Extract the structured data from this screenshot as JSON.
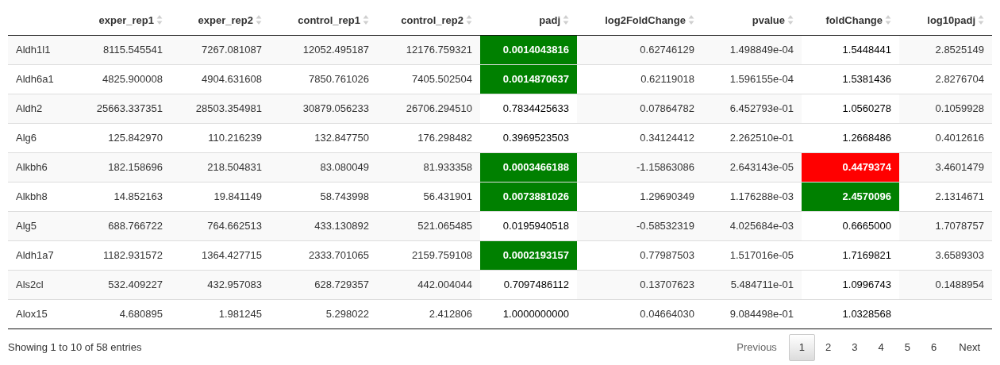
{
  "table": {
    "columns": [
      {
        "label": "exper_rep1",
        "kind": "plain"
      },
      {
        "label": "exper_rep2",
        "kind": "plain"
      },
      {
        "label": "control_rep1",
        "kind": "plain"
      },
      {
        "label": "control_rep2",
        "kind": "plain"
      },
      {
        "label": "padj",
        "kind": "flagged"
      },
      {
        "label": "log2FoldChange",
        "kind": "plain"
      },
      {
        "label": "pvalue",
        "kind": "plain"
      },
      {
        "label": "foldChange",
        "kind": "flagged"
      },
      {
        "label": "log10padj",
        "kind": "plain"
      }
    ],
    "rows": [
      {
        "gene": "Aldh1l1",
        "cells": [
          "8115.545541",
          "7267.081087",
          "12052.495187",
          "12176.759321",
          {
            "text": "0.0014043816",
            "color": "#008000"
          },
          "0.62746129",
          "1.498849e-04",
          "1.5448441",
          "2.8525149"
        ]
      },
      {
        "gene": "Aldh6a1",
        "cells": [
          "4825.900008",
          "4904.631608",
          "7850.761026",
          "7405.502504",
          {
            "text": "0.0014870637",
            "color": "#008000"
          },
          "0.62119018",
          "1.596155e-04",
          "1.5381436",
          "2.8276704"
        ]
      },
      {
        "gene": "Aldh2",
        "cells": [
          "25663.337351",
          "28503.354981",
          "30879.056233",
          "26706.294510",
          "0.7834425633",
          "0.07864782",
          "6.452793e-01",
          "1.0560278",
          "0.1059928"
        ]
      },
      {
        "gene": "Alg6",
        "cells": [
          "125.842970",
          "110.216239",
          "132.847750",
          "176.298482",
          "0.3969523503",
          "0.34124412",
          "2.262510e-01",
          "1.2668486",
          "0.4012616"
        ]
      },
      {
        "gene": "Alkbh6",
        "cells": [
          "182.158696",
          "218.504831",
          "83.080049",
          "81.933358",
          {
            "text": "0.0003466188",
            "color": "#008000"
          },
          "-1.15863086",
          "2.643143e-05",
          {
            "text": "0.4479374",
            "color": "#ff0000"
          },
          "3.4601479"
        ]
      },
      {
        "gene": "Alkbh8",
        "cells": [
          "14.852163",
          "19.841149",
          "58.743998",
          "56.431901",
          {
            "text": "0.0073881026",
            "color": "#008000"
          },
          "1.29690349",
          "1.176288e-03",
          {
            "text": "2.4570096",
            "color": "#008000"
          },
          "2.1314671"
        ]
      },
      {
        "gene": "Alg5",
        "cells": [
          "688.766722",
          "764.662513",
          "433.130892",
          "521.065485",
          "0.0195940518",
          "-0.58532319",
          "4.025684e-03",
          "0.6665000",
          "1.7078757"
        ]
      },
      {
        "gene": "Aldh1a7",
        "cells": [
          "1182.931572",
          "1364.427715",
          "2333.701065",
          "2159.759108",
          {
            "text": "0.0002193157",
            "color": "#008000"
          },
          "0.77987503",
          "1.517016e-05",
          "1.7169821",
          "3.6589303"
        ]
      },
      {
        "gene": "Als2cl",
        "cells": [
          "532.409227",
          "432.957083",
          "628.729357",
          "442.004044",
          "0.7097486112",
          "0.13707623",
          "5.484711e-01",
          "1.0996743",
          "0.1488954"
        ]
      },
      {
        "gene": "Alox15",
        "cells": [
          "4.680895",
          "1.981245",
          "5.298022",
          "2.412806",
          "1.0000000000",
          "0.04664030",
          "9.084498e-01",
          "1.0328568"
        ]
      }
    ]
  },
  "footer": {
    "info": "Showing 1 to 10 of 58 entries",
    "pagination": [
      {
        "label": "Previous",
        "kind": "nav",
        "disabled": true,
        "selected": false
      },
      {
        "label": "1",
        "kind": "page",
        "disabled": false,
        "selected": true
      },
      {
        "label": "2",
        "kind": "page",
        "disabled": false,
        "selected": false
      },
      {
        "label": "3",
        "kind": "page",
        "disabled": false,
        "selected": false
      },
      {
        "label": "4",
        "kind": "page",
        "disabled": false,
        "selected": false
      },
      {
        "label": "5",
        "kind": "page",
        "disabled": false,
        "selected": false
      },
      {
        "label": "6",
        "kind": "page",
        "disabled": false,
        "selected": false
      },
      {
        "label": "Next",
        "kind": "nav",
        "disabled": false,
        "selected": false
      }
    ]
  }
}
